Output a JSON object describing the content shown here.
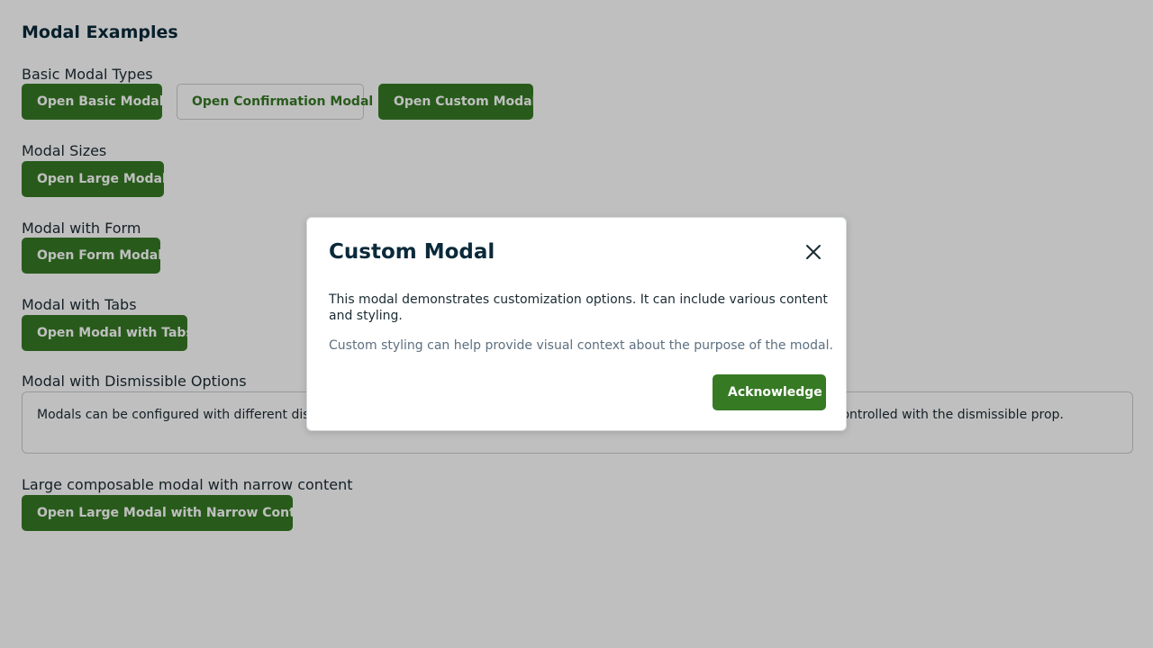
{
  "page": {
    "title": "Modal Examples"
  },
  "sections": {
    "basic": {
      "label": "Basic Modal Types",
      "basic_button": "Open Basic Modal",
      "confirmation_button": "Open Confirmation Modal",
      "custom_button": "Open Custom Modal"
    },
    "sizes": {
      "label": "Modal Sizes",
      "large_button": "Open Large Modal"
    },
    "form": {
      "label": "Modal with Form",
      "form_button": "Open Form Modal"
    },
    "tabs": {
      "label": "Modal with Tabs",
      "tabs_button": "Open Modal with Tabs"
    },
    "dismissible": {
      "label": "Modal with Dismissible Options",
      "description": "Modals can be configured with different dismissal behaviors, such as clicking the overlay or pressing the ESC key. This can be controlled with the dismissible prop."
    },
    "narrow": {
      "label": "Large composable modal with narrow content",
      "narrow_button": "Open Large Modal with Narrow Content"
    }
  },
  "modal": {
    "title": "Custom Modal",
    "close_icon": "close-icon",
    "body": "This modal demonstrates customization options. It can include various content and styling.",
    "note": "Custom styling can help provide visual context about the purpose of the modal.",
    "acknowledge_button": "Acknowledge"
  },
  "colors": {
    "primary": "#367a24",
    "overlay": "rgba(0,0,0,0.25)",
    "heading": "#0a2a3a",
    "muted_text": "#5d7080"
  }
}
